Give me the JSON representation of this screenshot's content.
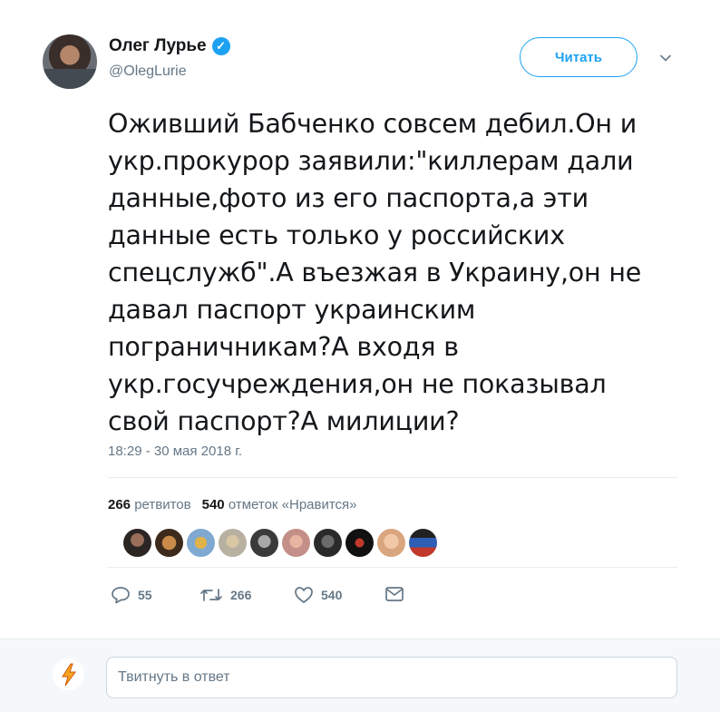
{
  "author": {
    "name": "Олег Лурье",
    "handle": "@OlegLurie",
    "verified_icon": "verified-badge-icon"
  },
  "follow_button": {
    "label": "Читать"
  },
  "tweet": {
    "lines": [
      "Оживший Бабченко совсем дебил.Он и",
      "укр.прокурор заявили:\"киллерам дали",
      "данные,фото из его паспорта,а эти",
      "данные есть только у российских",
      "спецслужб\".А въезжая в Украину,он не",
      "давал паспорт украинским",
      "пограничникам?А входя в",
      "укр.госучреждения,он не показывал",
      "свой паспорт?А милиции?"
    ],
    "timestamp": "18:29 - 30 мая 2018 г."
  },
  "stats": {
    "retweets_count": "266",
    "retweets_label": "ретвитов",
    "likes_count": "540",
    "likes_label": "отметок «Нравится»"
  },
  "likers": [
    "liker-1",
    "liker-2",
    "liker-3",
    "liker-4",
    "liker-5",
    "liker-6",
    "liker-7",
    "liker-8",
    "liker-9",
    "liker-10"
  ],
  "actions": {
    "reply_count": "55",
    "retweet_count": "266",
    "like_count": "540"
  },
  "reply": {
    "placeholder": "Твитнуть в ответ"
  },
  "colors": {
    "accent": "#1da1f2",
    "muted": "#657786",
    "text": "#14171a",
    "border": "#e6ecf0"
  }
}
